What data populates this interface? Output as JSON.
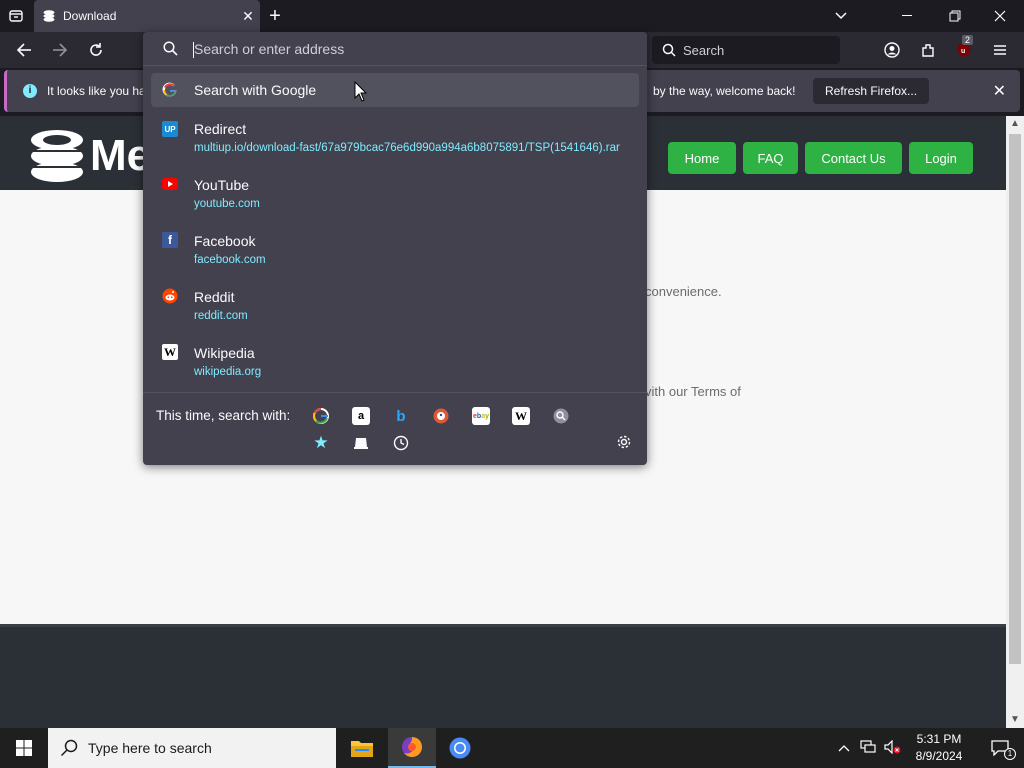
{
  "browser": {
    "tab": {
      "title": "Download",
      "close": "✕"
    },
    "new_tab": "+",
    "search_placeholder": "Search",
    "extension_badge": "2"
  },
  "notification": {
    "text_left": "It looks like you ha",
    "text_right": "by the way, welcome back!",
    "refresh_button": "Refresh Firefox...",
    "close": "✕"
  },
  "urlbar": {
    "placeholder": "Search or enter address",
    "suggestions": [
      {
        "title": "Search with Google",
        "url": "",
        "icon": "google-icon"
      },
      {
        "title": "Redirect",
        "url": "multiup.io/download-fast/67a979bcac76e6d990a994a6b8075891/TSP(1541646).rar",
        "icon": "multiup-icon"
      },
      {
        "title": "YouTube",
        "url": "youtube.com",
        "icon": "youtube-icon"
      },
      {
        "title": "Facebook",
        "url": "facebook.com",
        "icon": "facebook-icon"
      },
      {
        "title": "Reddit",
        "url": "reddit.com",
        "icon": "reddit-icon"
      },
      {
        "title": "Wikipedia",
        "url": "wikipedia.org",
        "icon": "wikipedia-icon"
      }
    ],
    "one_offs_label": "This time, search with:",
    "engines": [
      "google",
      "amazon",
      "bing",
      "duckduckgo",
      "ebay",
      "wikipedia",
      "search-engine",
      "bookmarks",
      "tabs",
      "history"
    ]
  },
  "page": {
    "logo_text": "Me",
    "nav": [
      "Home",
      "FAQ",
      "Contact Us",
      "Login"
    ],
    "text_fragment_1": "convenience.",
    "text_fragment_2": "vith our Terms of"
  },
  "taskbar": {
    "search_placeholder": "Type here to search",
    "time": "5:31 PM",
    "date": "8/9/2024",
    "notification_count": "1"
  },
  "colors": {
    "accent_cyan": "#80ebff",
    "nav_green": "#2fb244",
    "site_header": "#2b3036"
  }
}
